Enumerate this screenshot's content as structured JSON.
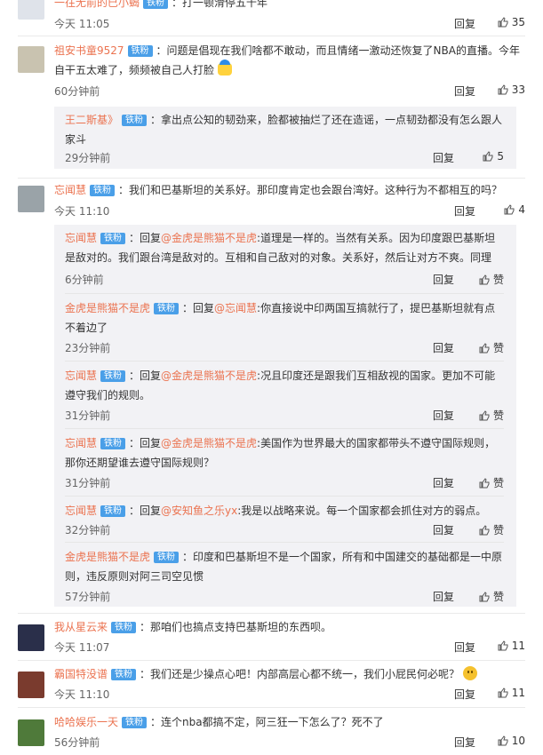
{
  "common": {
    "reply_label": "回复",
    "zan_label": "赞",
    "badge": "铁粉"
  },
  "colors": {
    "username": "#eb7350",
    "badge_bg": "#4a9fe8",
    "sub_bg": "#f2f2f5"
  },
  "comments": [
    {
      "user": "一往无前的巳小蝎",
      "text": "：打一顿滑停五千年",
      "time": "今天 11:05",
      "likes": "35"
    },
    {
      "user": "祖安书童9527",
      "text": "：问题是倡现在我们啥都不敢动，而且情绪一激动还恢复了NBA的直播。今年自干五太难了，频频被自己人打脸",
      "time": "60分钟前",
      "likes": "33",
      "subs": [
        {
          "user": "王二斯基》",
          "text": "：拿出点公知的韧劲来，脸都被抽烂了还在造谣，一点韧劲都没有怎么跟人家斗",
          "time": "29分钟前",
          "likes": "5"
        }
      ]
    },
    {
      "user": "忘闻慧",
      "text": "：我们和巴基斯坦的关系好。那印度肯定也会跟台湾好。这种行为不都相互的吗？",
      "time": "今天 11:10",
      "likes": "4",
      "subs": [
        {
          "user": "忘闻慧",
          "pre": "：回复",
          "mention": "@金虎是熊猫不是虎",
          "text": ":道理是一样的。当然有关系。因为印度跟巴基斯坦是敌对的。我们跟台湾是敌对的。互相和自己敌对的对象。关系好，然后让对方不爽。同理",
          "time": "6分钟前",
          "likes": "赞"
        },
        {
          "user": "金虎是熊猫不是虎",
          "pre": "：回复",
          "mention": "@忘闻慧",
          "text": ":你直接说中印两国互搞就行了，提巴基斯坦就有点不着边了",
          "time": "23分钟前",
          "likes": "赞"
        },
        {
          "user": "忘闻慧",
          "pre": "：回复",
          "mention": "@金虎是熊猫不是虎",
          "text": ":况且印度还是跟我们互相敌视的国家。更加不可能遵守我们的规则。",
          "time": "31分钟前",
          "likes": "赞"
        },
        {
          "user": "忘闻慧",
          "pre": "：回复",
          "mention": "@金虎是熊猫不是虎",
          "text": ":美国作为世界最大的国家都带头不遵守国际规则，那你还期望谁去遵守国际规则？",
          "time": "31分钟前",
          "likes": "赞"
        },
        {
          "user": "忘闻慧",
          "pre": "：回复",
          "mention": "@安知鱼之乐yx",
          "text": ":我是以战略来说。每一个国家都会抓住对方的弱点。",
          "time": "32分钟前",
          "likes": "赞"
        },
        {
          "user": "金虎是熊猫不是虎",
          "text": "：印度和巴基斯坦不是一个国家，所有和中国建交的基础都是一中原则，违反原则对阿三司空见惯",
          "time": "57分钟前",
          "likes": "赞"
        }
      ]
    },
    {
      "user": "我从星云来",
      "text": "：那咱们也搞点支持巴基斯坦的东西呗。",
      "time": "今天 11:07",
      "likes": "11"
    },
    {
      "user": "霸国特没谱",
      "text": "：我们还是少操点心吧！内部高层心都不统一，我们小屁民何必呢？",
      "time": "今天 11:10",
      "likes": "11"
    },
    {
      "user": "哈哈娱乐一天",
      "text": "：连个nba都搞不定，阿三狂一下怎么了？死不了",
      "time": "56分钟前",
      "likes": "10"
    }
  ]
}
